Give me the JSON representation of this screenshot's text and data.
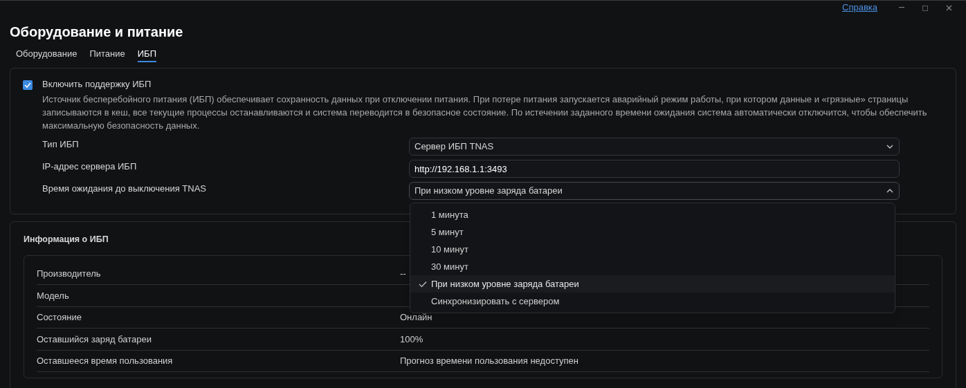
{
  "window": {
    "help_link": "Справка"
  },
  "title": "Оборудование и питание",
  "tabs": [
    {
      "label": "Оборудование",
      "selected": false
    },
    {
      "label": "Питание",
      "selected": false
    },
    {
      "label": "ИБП",
      "selected": true
    }
  ],
  "ups_settings": {
    "enable": {
      "label": "Включить поддержку ИБП",
      "checked": true
    },
    "description": "Источник бесперебойного питания (ИБП) обеспечивает сохранность данных при отключении питания. При потере питания запускается аварийный режим работы, при котором данные и «грязные» страницы записываются в кеш, все текущие процессы останавливаются и система переводится в безопасное состояние. По истечении заданного времени ожидания система автоматически отключится, чтобы обеспечить максимальную безопасность данных.",
    "fields": [
      {
        "kind": "select",
        "label": "Тип ИБП",
        "value": "Сервер ИБП TNAS",
        "expanded": false
      },
      {
        "kind": "input",
        "label": "IP-адрес сервера ИБП",
        "value": "http://192.168.1.1:3493"
      },
      {
        "kind": "select",
        "label": "Время ожидания до выключения TNAS",
        "value": "При низком уровне заряда батареи",
        "expanded": true,
        "options": [
          {
            "label": "1 минута",
            "selected": false
          },
          {
            "label": "5 минут",
            "selected": false
          },
          {
            "label": "10 минут",
            "selected": false
          },
          {
            "label": "30 минут",
            "selected": false
          },
          {
            "label": "При низком уровне заряда батареи",
            "selected": true
          },
          {
            "label": "Синхронизировать с сервером",
            "selected": false
          }
        ]
      }
    ]
  },
  "ups_info": {
    "title": "Информация о ИБП",
    "rows": [
      {
        "label": "Производитель",
        "value": "--"
      },
      {
        "label": "Модель"
      },
      {
        "label": "Состояние",
        "value": "Онлайн"
      },
      {
        "label": "Оставшийся заряд батареи",
        "value": "100%"
      },
      {
        "label": "Оставшееся время пользования",
        "value": "Прогноз времени пользования недоступен"
      }
    ]
  }
}
